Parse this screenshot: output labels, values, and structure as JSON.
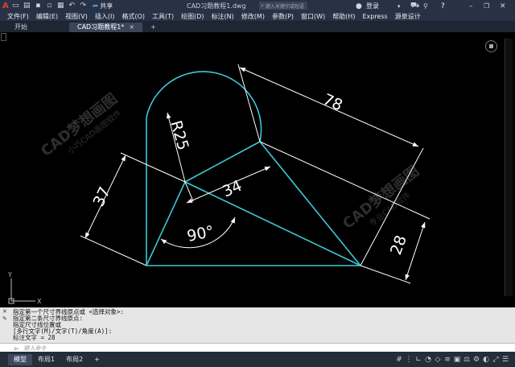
{
  "title_bar": {
    "window_title": "CAD习题教程1.dwg",
    "share_label": "共享",
    "search_placeholder": "键入关键字或短语",
    "login_label": "登录",
    "brand_letter": "A"
  },
  "menu": {
    "items": [
      "文件(F)",
      "编辑(E)",
      "视图(V)",
      "插入(I)",
      "格式(O)",
      "工具(T)",
      "绘图(D)",
      "标注(N)",
      "修改(M)",
      "参数(P)",
      "窗口(W)",
      "帮助(H)",
      "Express",
      "源泉设计"
    ]
  },
  "tabs": {
    "start": "开始",
    "document": "CAD习题教程1*",
    "close_glyph": "×",
    "add_glyph": "+"
  },
  "drawing": {
    "dim_78": "78",
    "dim_r25": "R25",
    "dim_37": "37",
    "dim_34": "34",
    "dim_90": "90°",
    "dim_28": "28",
    "watermark_title": "CAD梦想画图",
    "watermark_sub1": "小巧CAD画图软件",
    "watermark_sub2": "专业CAD软件",
    "ucs_x": "X",
    "ucs_y": "Y",
    "colors": {
      "geometry": "#3ec8d6",
      "dimensions": "#ffffff",
      "background": "#000000"
    }
  },
  "command": {
    "history": [
      "指定第一个尺寸界线原点或 <选择对象>:",
      "指定第二条尺寸界线原点:",
      "指定尺寸线位置或",
      "[多行文字(M)/文字(T)/角度(A)]:",
      "标注文字 = 28"
    ],
    "input_placeholder": "键入命令"
  },
  "status": {
    "tabs": [
      "模型",
      "布局1",
      "布局2"
    ],
    "add": "+"
  }
}
